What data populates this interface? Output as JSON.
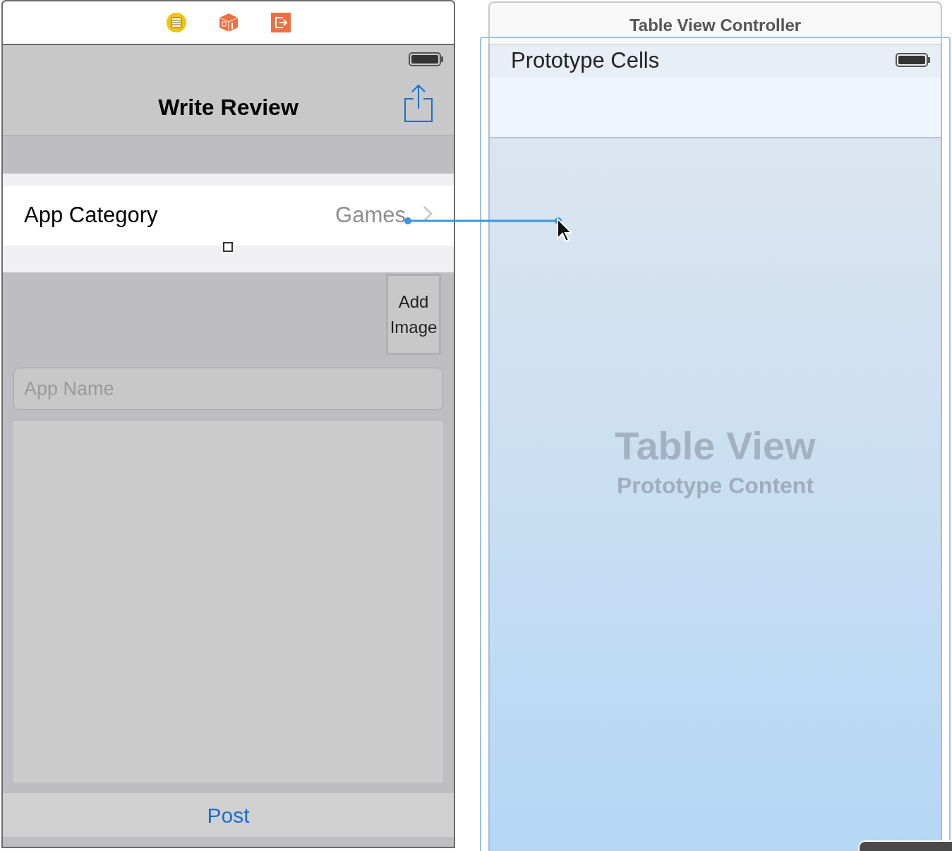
{
  "left_scene": {
    "nav_bar": {
      "title": "Write Review"
    },
    "category_cell": {
      "label": "App Category",
      "value": "Games"
    },
    "add_image_button": {
      "label": "Add Image"
    },
    "app_name_field": {
      "placeholder": "App Name"
    },
    "toolbar": {
      "button": "Post"
    }
  },
  "right_scene": {
    "title": "Table View Controller",
    "selected": true,
    "section_header": "Prototype Cells",
    "placeholder_title": "Table View",
    "placeholder_subtitle": "Prototype Content"
  }
}
